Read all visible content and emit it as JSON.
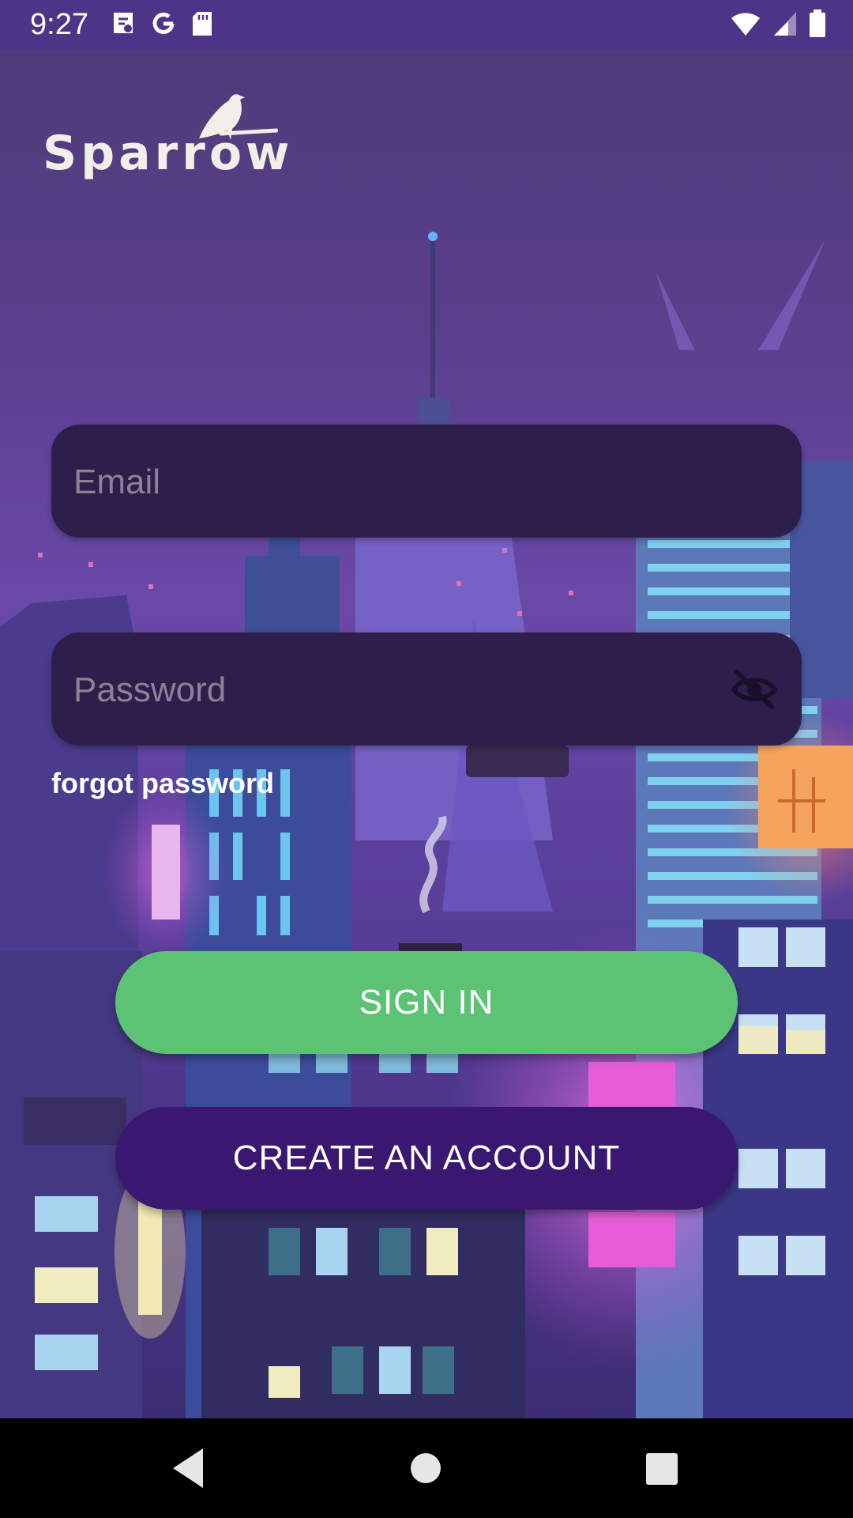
{
  "status_bar": {
    "time": "9:27",
    "left_icons": [
      "maps-icon",
      "google-icon",
      "sd-card-icon"
    ],
    "right_icons": [
      "wifi-icon",
      "signal-icon",
      "battery-icon"
    ]
  },
  "logo": {
    "text": "Sparrow",
    "icon": "sparrow-bird-icon"
  },
  "login_form": {
    "email_placeholder": "Email",
    "password_placeholder": "Password",
    "visibility_toggle_icon": "eye-off-icon",
    "forgot_password": "forgot password"
  },
  "actions": {
    "sign_in": "SIGN IN",
    "create_account": "CREATE AN ACCOUNT"
  },
  "nav_bar": {
    "icons": [
      "back-icon",
      "home-icon",
      "recents-icon"
    ]
  },
  "colors": {
    "status_bar": "#4e3486",
    "input_background": "#2e1e4c",
    "sign_in_button": "#5cc374",
    "create_account_button": "#3a1770",
    "placeholder_text": "#8c8295"
  }
}
